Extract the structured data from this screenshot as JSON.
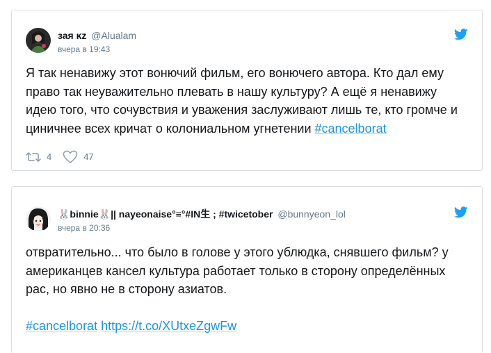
{
  "tweets": [
    {
      "display_name": "зая ĸz",
      "handle": "@Alualam",
      "timestamp": "вчера в 19:43",
      "text": "Я так ненавижу этот вонючий фильм, его вонючего автора. Кто дал ему право так неуважительно плевать в нашу культуру? А ещё я ненавижу идею того, что сочувствия и уважения заслуживают лишь те, кто громче и циничнее всех кричат о колониальном угнетении ",
      "hashtag": "#cancelborat",
      "retweets": "4",
      "likes": "47",
      "retweet_icon": "retweet-icon",
      "like_icon": "heart-icon",
      "logo_icon": "twitter-bird-icon"
    },
    {
      "display_name": "🐰binnie🐰|| nayeonaise°≡°#IN生 ; #twicetober",
      "handle": "@bunnyeon_lol",
      "timestamp": "вчера в 20:36",
      "text": "отвратительно... что было в голове у этого ублюдка, снявшего фильм? у американцев кансел культура работает только в сторону определённых рас, но явно не в сторону азиатов.",
      "hashtag": "#cancelborat",
      "link": "https://t.co/XUtxeZgwFw",
      "logo_icon": "twitter-bird-icon"
    }
  ],
  "colors": {
    "link": "#1b95e0",
    "meta": "#657786",
    "text": "#14171a",
    "border": "#d9dde0"
  }
}
